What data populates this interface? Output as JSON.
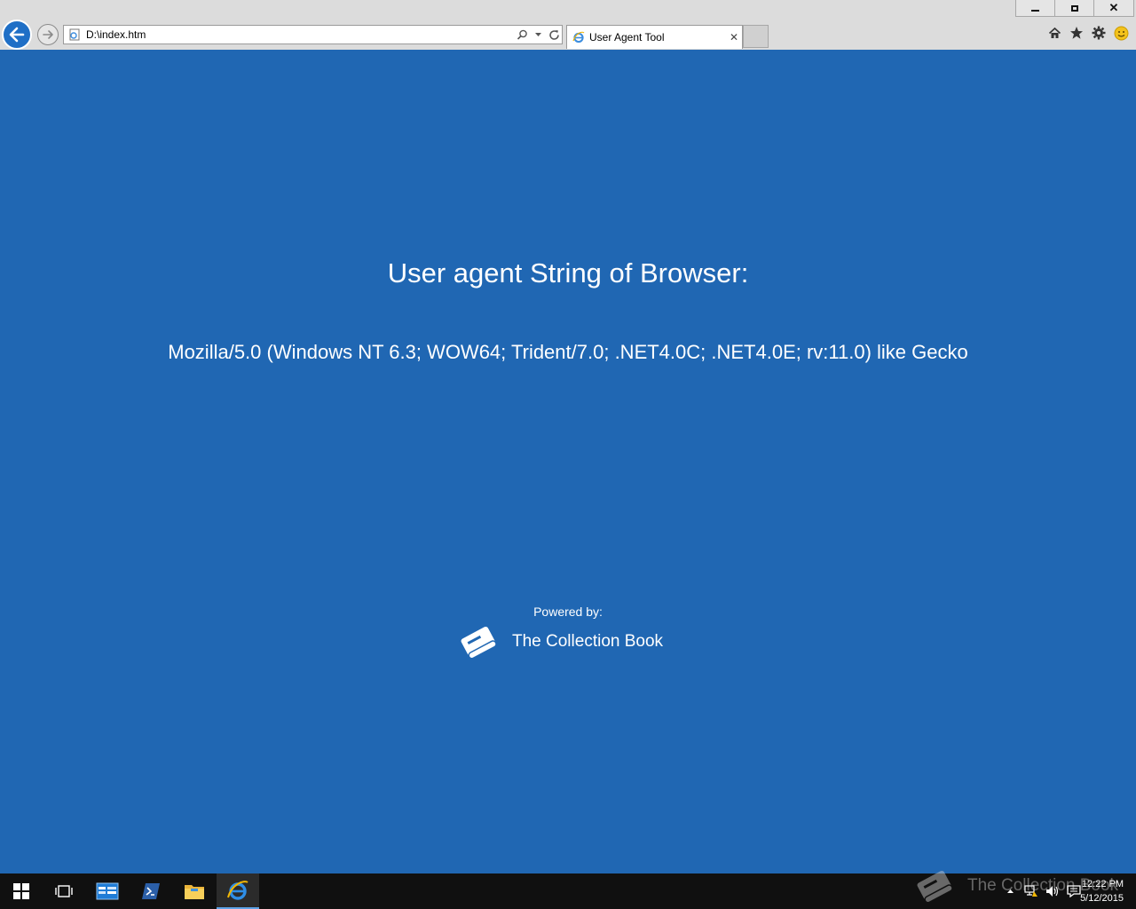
{
  "window": {
    "minimize_label": "",
    "restore_label": "",
    "close_label": "✕"
  },
  "address_bar": {
    "url": "D:\\index.htm"
  },
  "tab": {
    "title": "User Agent Tool",
    "close_label": "✕"
  },
  "page": {
    "heading": "User agent String of Browser:",
    "user_agent": "Mozilla/5.0 (Windows NT 6.3; WOW64; Trident/7.0; .NET4.0C; .NET4.0E; rv:11.0) like Gecko",
    "powered_by": "Powered by:",
    "brand": "The Collection Book"
  },
  "taskbar": {
    "items": [
      "start",
      "task-view",
      "server-manager",
      "powershell",
      "file-explorer",
      "internet-explorer"
    ],
    "active_item": "internet-explorer",
    "watermark": "The Collection Book",
    "clock_time": "12:22 PM",
    "clock_date": "5/12/2015"
  },
  "colors": {
    "page_background": "#2067b3",
    "chrome_background": "#dcdcdc",
    "back_button": "#1f6fc6",
    "taskbar": "#101010"
  },
  "icons": [
    "back-arrow-icon",
    "forward-arrow-icon",
    "page-icon",
    "search-icon",
    "dropdown-icon",
    "refresh-icon",
    "ie-icon",
    "home-icon",
    "star-icon",
    "gear-icon",
    "smiley-icon",
    "book-icon",
    "windows-icon",
    "task-view-icon",
    "server-manager-icon",
    "powershell-icon",
    "folder-icon",
    "tray-up-icon",
    "network-icon",
    "speaker-icon",
    "notifications-icon"
  ]
}
